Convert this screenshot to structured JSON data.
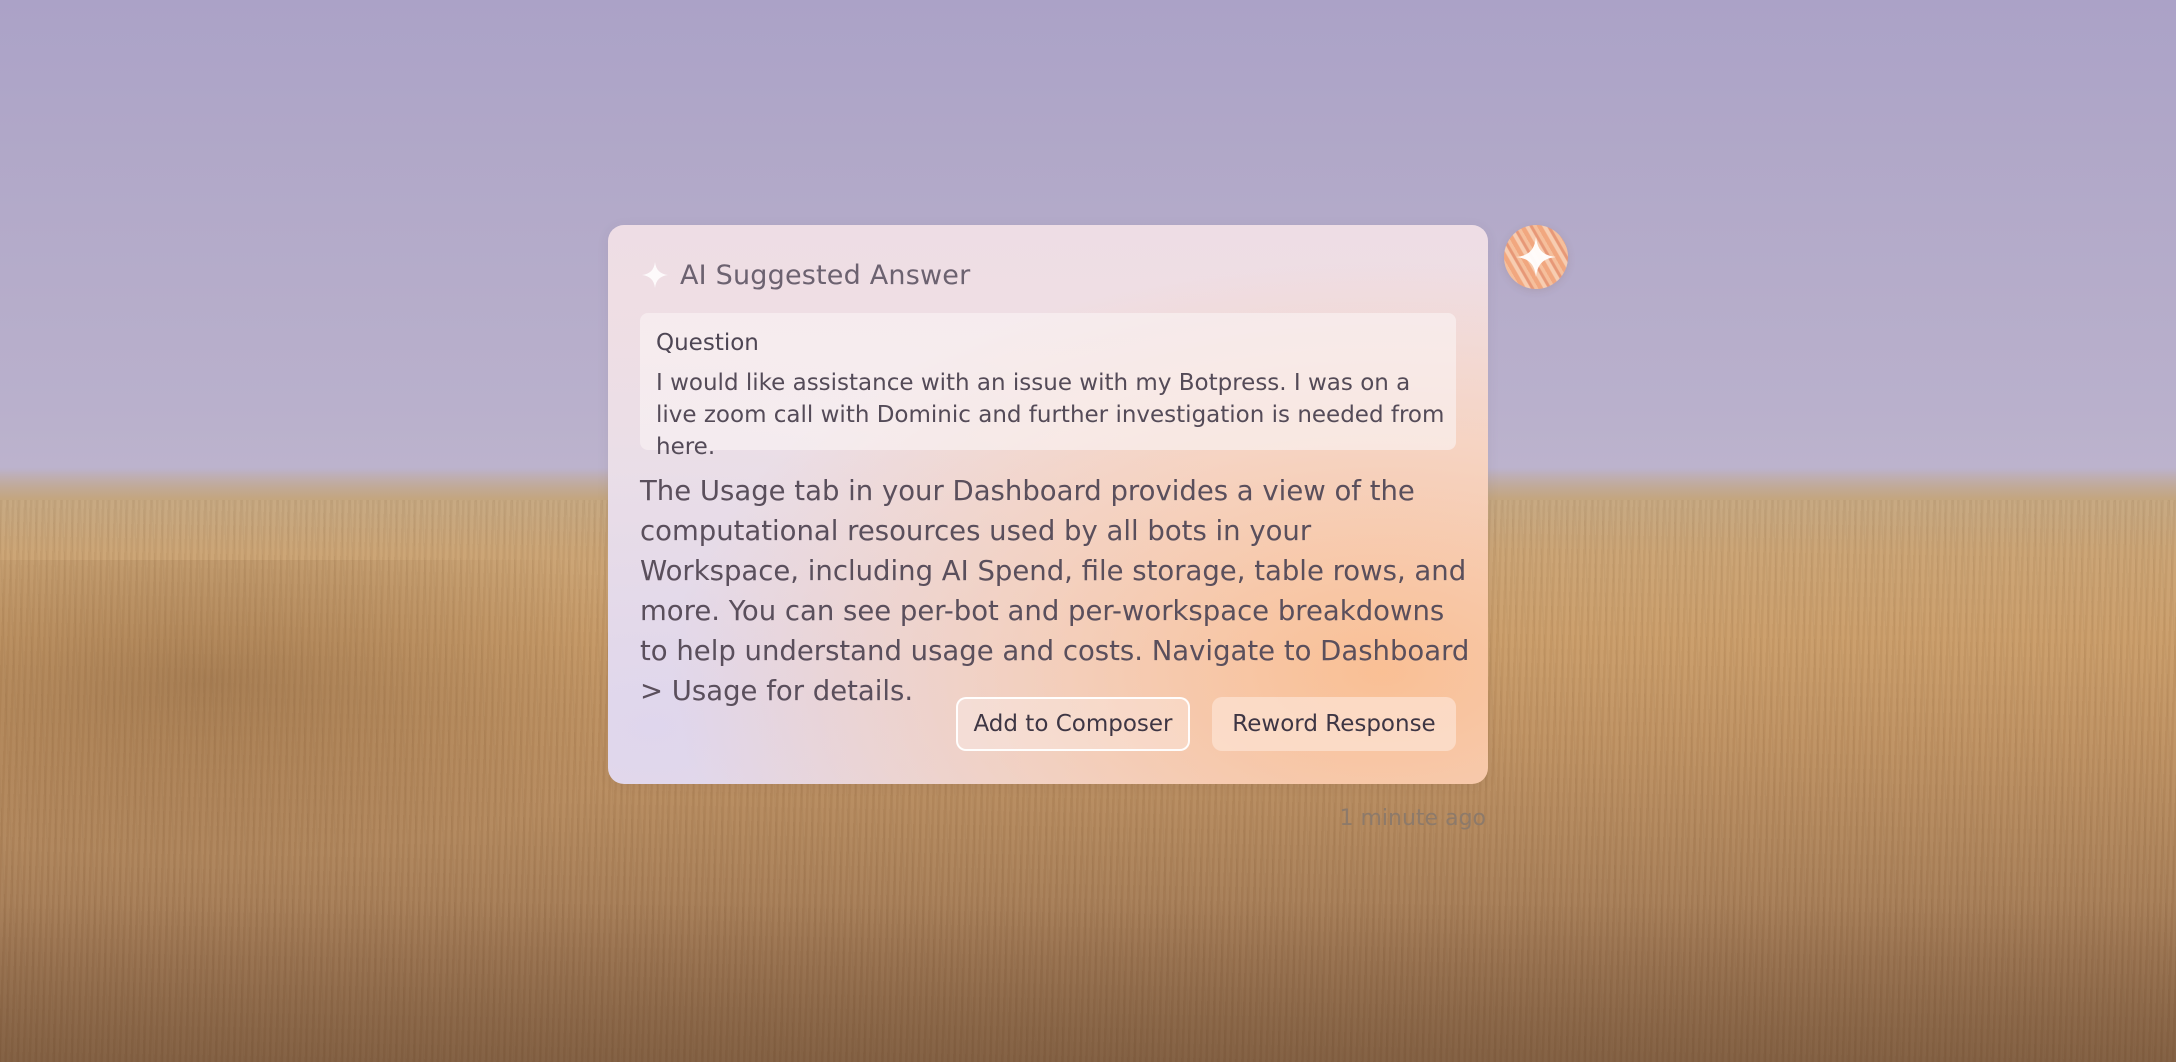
{
  "card": {
    "title": "AI Suggested Answer",
    "question": {
      "label": "Question",
      "text": "I would like assistance with an issue with my Botpress. I was on a live zoom call with Dominic and further investigation is needed from here."
    },
    "answer": "The Usage tab in your Dashboard provides a view of the computational resources used by all bots in your Workspace, including AI Spend, file storage, table rows, and more. You can see per-bot and per-workspace breakdowns to help understand usage and costs. Navigate to Dashboard > Usage for details.",
    "buttons": {
      "add_to_composer": "Add to Composer",
      "reword_response": "Reword Response"
    }
  },
  "timestamp": "1 minute ago",
  "icons": {
    "header": "sparkle-icon",
    "avatar": "ai-sparkle-avatar"
  },
  "colors": {
    "title_text": "#6c6270",
    "body_text": "#5a4f5c",
    "reword_button_bg": "#fce2d2",
    "avatar_accent": "#f1a77f"
  }
}
